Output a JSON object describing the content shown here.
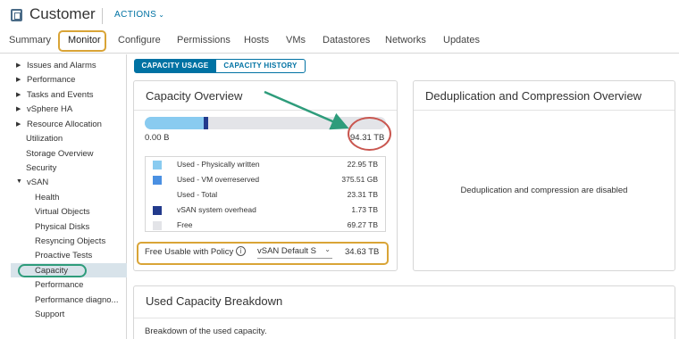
{
  "header": {
    "title": "Customer",
    "actions_label": "ACTIONS"
  },
  "tabs": [
    {
      "label": "Summary"
    },
    {
      "label": "Monitor"
    },
    {
      "label": "Configure"
    },
    {
      "label": "Permissions"
    },
    {
      "label": "Hosts"
    },
    {
      "label": "VMs"
    },
    {
      "label": "Datastores"
    },
    {
      "label": "Networks"
    },
    {
      "label": "Updates"
    }
  ],
  "sidebar": {
    "items": [
      {
        "label": "Issues and Alarms"
      },
      {
        "label": "Performance"
      },
      {
        "label": "Tasks and Events"
      },
      {
        "label": "vSphere HA"
      },
      {
        "label": "Resource Allocation"
      },
      {
        "label": "Utilization"
      },
      {
        "label": "Storage Overview"
      },
      {
        "label": "Security"
      },
      {
        "label": "vSAN"
      },
      {
        "label": "Health"
      },
      {
        "label": "Virtual Objects"
      },
      {
        "label": "Physical Disks"
      },
      {
        "label": "Resyncing Objects"
      },
      {
        "label": "Proactive Tests"
      },
      {
        "label": "Capacity"
      },
      {
        "label": "Performance"
      },
      {
        "label": "Performance diagno..."
      },
      {
        "label": "Support"
      }
    ]
  },
  "view_toggle": {
    "usage_label": "CAPACITY USAGE",
    "history_label": "CAPACITY HISTORY"
  },
  "capacity_overview": {
    "title": "Capacity Overview",
    "bar_min": "0.00 B",
    "bar_max": "94.31 TB",
    "used_fraction": 0.2434,
    "overhead_fraction": 0.0183,
    "legend": [
      {
        "label": "Used - Physically written",
        "value": "22.95 TB",
        "color": "#89cbf0"
      },
      {
        "label": "Used - VM overreserved",
        "value": "375.51 GB",
        "color": "#4a90e2"
      },
      {
        "label": "Used - Total",
        "value": "23.31 TB",
        "color": ""
      },
      {
        "label": "vSAN system overhead",
        "value": "1.73 TB",
        "color": "#223a8c"
      },
      {
        "label": "Free",
        "value": "69.27 TB",
        "color": "#e3e4e8"
      }
    ],
    "policy_label": "Free Usable with Policy",
    "policy_selected": "vSAN Default S",
    "policy_value": "34.63 TB"
  },
  "dedup": {
    "title": "Deduplication and Compression Overview",
    "message": "Deduplication and compression are disabled"
  },
  "breakdown": {
    "title": "Used Capacity Breakdown",
    "description": "Breakdown of the used capacity."
  },
  "colors": {
    "accent": "#0072a3",
    "highlight_gold": "#d9a436",
    "highlight_green": "#2e9c7b",
    "highlight_red": "#c9564f",
    "arrow": "#2e9c7b"
  }
}
